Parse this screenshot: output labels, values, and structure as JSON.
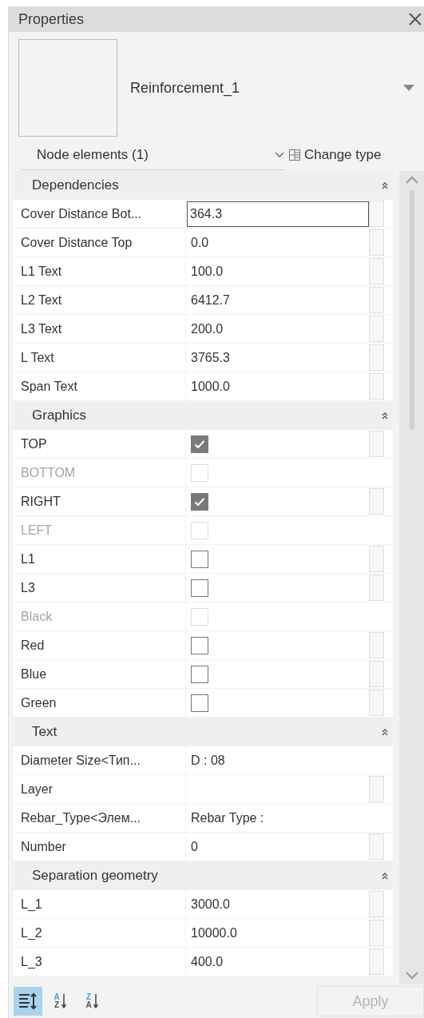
{
  "panel": {
    "title": "Properties"
  },
  "type_selector": {
    "name": "Reinforcement_1"
  },
  "filter": {
    "label": "Node elements (1)"
  },
  "change_type": {
    "label": "Change type"
  },
  "sections": [
    {
      "title": "Dependencies",
      "expanded": true,
      "rows": [
        {
          "kind": "value",
          "label": "Cover Distance Bot...",
          "value": "364.3",
          "editing": true,
          "disabled": false,
          "side_button": true
        },
        {
          "kind": "value",
          "label": "Cover Distance Top",
          "value": "0.0",
          "editing": false,
          "disabled": false,
          "side_button": true
        },
        {
          "kind": "value",
          "label": "L1 Text",
          "value": "100.0",
          "editing": false,
          "disabled": false,
          "side_button": true
        },
        {
          "kind": "value",
          "label": "L2 Text",
          "value": "6412.7",
          "editing": false,
          "disabled": false,
          "side_button": true
        },
        {
          "kind": "value",
          "label": "L3 Text",
          "value": "200.0",
          "editing": false,
          "disabled": false,
          "side_button": true
        },
        {
          "kind": "value",
          "label": "L Text",
          "value": "3765.3",
          "editing": false,
          "disabled": false,
          "side_button": true
        },
        {
          "kind": "value",
          "label": "Span Text",
          "value": "1000.0",
          "editing": false,
          "disabled": false,
          "side_button": true
        }
      ]
    },
    {
      "title": "Graphics",
      "expanded": true,
      "rows": [
        {
          "kind": "checkbox",
          "label": "TOP",
          "checked": true,
          "disabled": false,
          "side_button": true
        },
        {
          "kind": "checkbox",
          "label": "BOTTOM",
          "checked": false,
          "disabled": true,
          "side_button": false
        },
        {
          "kind": "checkbox",
          "label": "RIGHT",
          "checked": true,
          "disabled": false,
          "side_button": true
        },
        {
          "kind": "checkbox",
          "label": "LEFT",
          "checked": false,
          "disabled": true,
          "side_button": false
        },
        {
          "kind": "checkbox",
          "label": "L1",
          "checked": false,
          "disabled": false,
          "side_button": true
        },
        {
          "kind": "checkbox",
          "label": "L3",
          "checked": false,
          "disabled": false,
          "side_button": true
        },
        {
          "kind": "checkbox",
          "label": "Black",
          "checked": false,
          "disabled": true,
          "side_button": false
        },
        {
          "kind": "checkbox",
          "label": "Red",
          "checked": false,
          "disabled": false,
          "side_button": true
        },
        {
          "kind": "checkbox",
          "label": "Blue",
          "checked": false,
          "disabled": false,
          "side_button": true
        },
        {
          "kind": "checkbox",
          "label": "Green",
          "checked": false,
          "disabled": false,
          "side_button": true
        }
      ]
    },
    {
      "title": "Text",
      "expanded": true,
      "rows": [
        {
          "kind": "value",
          "label": "Diameter Size<Тип...",
          "value": "D : 08",
          "editing": false,
          "disabled": false,
          "side_button": false
        },
        {
          "kind": "value",
          "label": "Layer",
          "editing": false,
          "disabled": false,
          "side_button": true
        },
        {
          "kind": "value",
          "label": "Rebar_Type<Элем...",
          "value": "Rebar Type :",
          "editing": false,
          "disabled": false,
          "side_button": false
        },
        {
          "kind": "value",
          "label": "Number",
          "value": "0",
          "editing": false,
          "disabled": false,
          "side_button": true
        }
      ]
    },
    {
      "title": "Separation geometry",
      "expanded": true,
      "rows": [
        {
          "kind": "value",
          "label": "L_1",
          "value": "3000.0",
          "editing": false,
          "disabled": false,
          "side_button": true
        },
        {
          "kind": "value",
          "label": "L_2",
          "value": "10000.0",
          "editing": false,
          "disabled": false,
          "side_button": true
        },
        {
          "kind": "value",
          "label": "L_3",
          "value": "400.0",
          "editing": false,
          "disabled": false,
          "side_button": true
        }
      ]
    }
  ],
  "toolbar": [
    {
      "kind": "categorized",
      "selected": true
    },
    {
      "kind": "sort",
      "top": "A",
      "bottom": "Z",
      "selected": false
    },
    {
      "kind": "sort",
      "top": "Z",
      "bottom": "A",
      "selected": false
    }
  ],
  "apply_button": {
    "label": "Apply",
    "disabled": true
  }
}
